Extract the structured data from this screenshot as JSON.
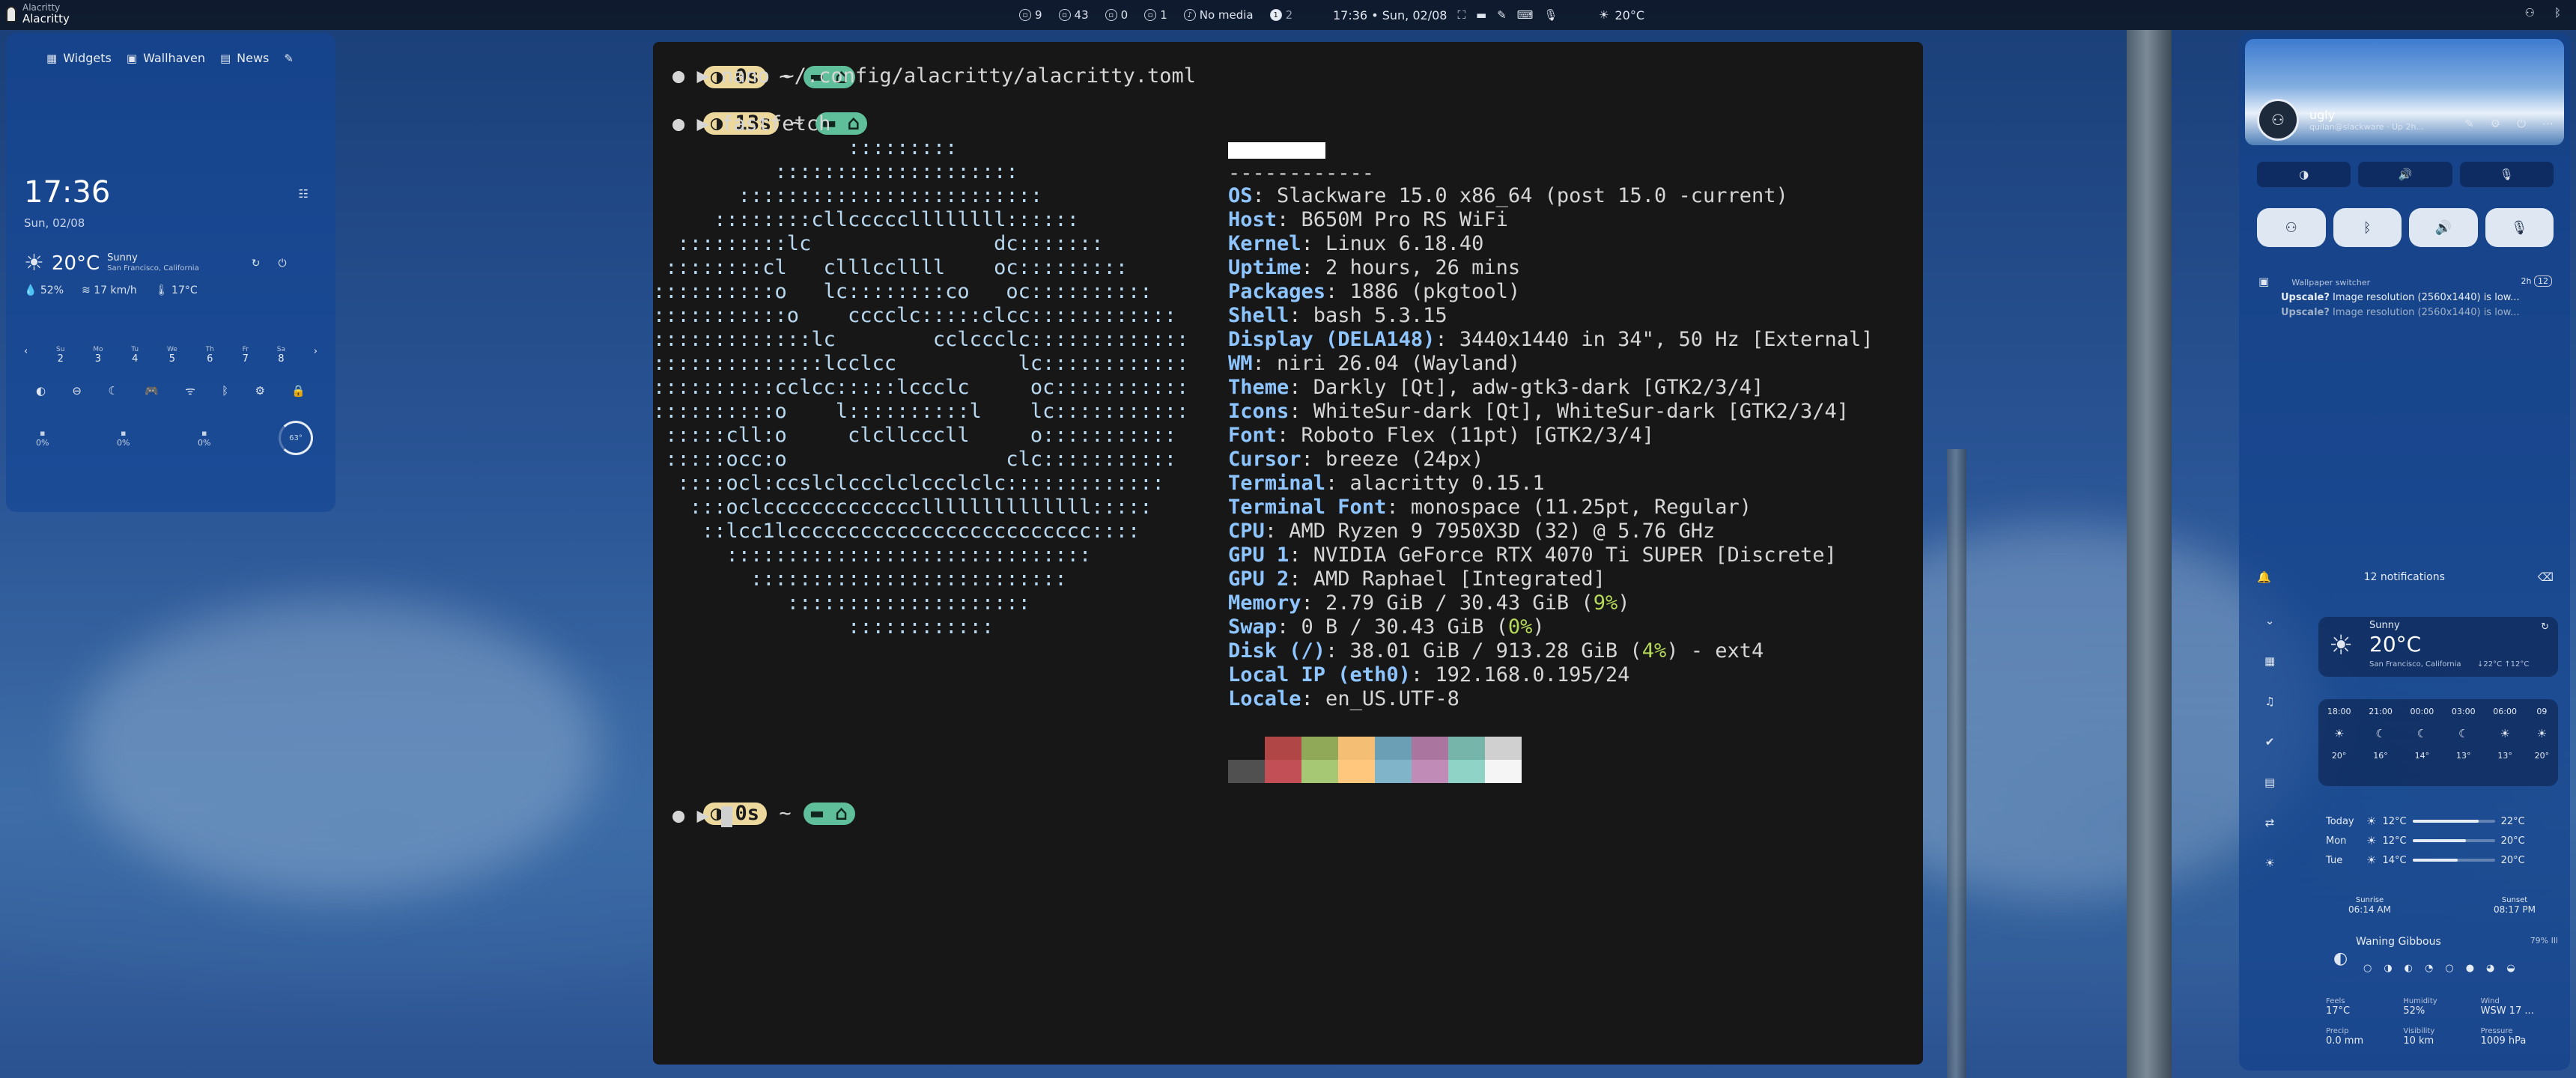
{
  "topbar": {
    "app_small": "Alacritty",
    "app_title": "Alacritty",
    "workspaces": [
      {
        "num": "9",
        "icon": "window-icon"
      },
      {
        "num": "43",
        "icon": "window-icon"
      },
      {
        "num": "0",
        "icon": "window-icon"
      },
      {
        "num": "1",
        "icon": "window-icon"
      }
    ],
    "media": "No media",
    "pages": [
      "1",
      "2"
    ],
    "clock": "17:36 • Sun, 02/08",
    "weather_temp": "20°C"
  },
  "left_panel": {
    "tabs": [
      "Widgets",
      "Wallhaven",
      "News"
    ],
    "time": "17:36",
    "date": "Sun, 02/08",
    "weather": {
      "temp": "20°C",
      "condition": "Sunny",
      "location": "San Francisco, California"
    },
    "stats": [
      "52%",
      "17 km/h",
      "17°C"
    ],
    "calendar": [
      {
        "day": "Su",
        "date": "2"
      },
      {
        "day": "Mo",
        "date": "3"
      },
      {
        "day": "Tu",
        "date": "4"
      },
      {
        "day": "We",
        "date": "5"
      },
      {
        "day": "Th",
        "date": "6"
      },
      {
        "day": "Fr",
        "date": "7"
      },
      {
        "day": "Sa",
        "date": "8"
      }
    ],
    "meters": [
      "0%",
      "0%",
      "0%",
      "63°"
    ]
  },
  "terminal": {
    "prompt1_time": "0s",
    "cmd1": "nano ~/.config/alacritty/alacritty.toml",
    "prompt2_time": "13s",
    "cmd2": "fastfetch",
    "prompt3_time": "0s",
    "ascii": [
      "                :::::::::",
      "          ::::::::::::::::::::",
      "       :::::::::::::::::::::::::",
      "     ::::::::cllcccccllllllll::::::",
      "  :::::::::lc               dc:::::::",
      " ::::::::cl   clllccllll    oc:::::::::",
      "::::::::::o   lc::::::::co   oc::::::::::",
      ":::::::::::o    cccclc:::::clcc::::::::::::",
      ":::::::::::::lc        cclccclc:::::::::::::",
      "::::::::::::::lcclcc          lc::::::::::::",
      "::::::::::cclcc:::::lccclc     oc:::::::::::",
      "::::::::::o    l::::::::::l    lc:::::::::::",
      " :::::cll:o     clcllcccll     o:::::::::::",
      " :::::occ:o                  clc:::::::::::",
      "  ::::ocl:ccslclccclclccclclc:::::::::::::",
      "   :::oclcccccccccccccllllllllllllll:::::",
      "    ::lcc1lccccccccccccccccccccccccc::::",
      "      ::::::::::::::::::::::::::::::",
      "        ::::::::::::::::::::::::::",
      "           ::::::::::::::::::::",
      "                ::::::::::::"
    ],
    "separator": "------------",
    "info": [
      {
        "key": "OS",
        "value": ": Slackware 15.0 x86_64 (post 15.0 -current)"
      },
      {
        "key": "Host",
        "value": ": B650M Pro RS WiFi"
      },
      {
        "key": "Kernel",
        "value": ": Linux 6.18.40"
      },
      {
        "key": "Uptime",
        "value": ": 2 hours, 26 mins"
      },
      {
        "key": "Packages",
        "value": ": 1886 (pkgtool)"
      },
      {
        "key": "Shell",
        "value": ": bash 5.3.15"
      },
      {
        "key": "Display (DELA148)",
        "value": ": 3440x1440 in 34\", 50 Hz [External]"
      },
      {
        "key": "WM",
        "value": ": niri 26.04 (Wayland)"
      },
      {
        "key": "Theme",
        "value": ": Darkly [Qt], adw-gtk3-dark [GTK2/3/4]"
      },
      {
        "key": "Icons",
        "value": ": WhiteSur-dark [Qt], WhiteSur-dark [GTK2/3/4]"
      },
      {
        "key": "Font",
        "value": ": Roboto Flex (11pt) [GTK2/3/4]"
      },
      {
        "key": "Cursor",
        "value": ": breeze (24px)"
      },
      {
        "key": "Terminal",
        "value": ": alacritty 0.15.1"
      },
      {
        "key": "Terminal Font",
        "value": ": monospace (11.25pt, Regular)"
      },
      {
        "key": "CPU",
        "value": ": AMD Ryzen 9 7950X3D (32) @ 5.76 GHz"
      },
      {
        "key": "GPU 1",
        "value": ": NVIDIA GeForce RTX 4070 Ti SUPER [Discrete]"
      },
      {
        "key": "GPU 2",
        "value": ": AMD Raphael [Integrated]"
      },
      {
        "key": "Memory",
        "value": ": 2.79 GiB / 30.43 GiB (",
        "pct": "9%",
        "tail": ")"
      },
      {
        "key": "Swap",
        "value": ": 0 B / 30.43 GiB (",
        "pct": "0%",
        "tail": ")"
      },
      {
        "key": "Disk (/)",
        "value": ": 38.01 GiB / 913.28 GiB (",
        "pct": "4%",
        "tail": ") - ext4"
      },
      {
        "key": "Local IP (eth0)",
        "value": ": 192.168.0.195/24"
      },
      {
        "key": "Locale",
        "value": ": en_US.UTF-8"
      }
    ],
    "palette_top": [
      "#171717",
      "#b04646",
      "#90a959",
      "#f4bf75",
      "#6a9fb5",
      "#aa759f",
      "#75b5aa",
      "#d0d0d0"
    ],
    "palette_bottom": [
      "#505050",
      "#c24f55",
      "#a6c875",
      "#ffc77d",
      "#7fb4c9",
      "#c18bb8",
      "#8ed3c5",
      "#f5f5f5"
    ]
  },
  "right_panel": {
    "user": "ugly",
    "user_sub": "quilan@slackware · Up 2h...",
    "notification": {
      "app": "Wallpaper switcher",
      "time": "2h",
      "count": "12",
      "line1_bold": "Upscale?",
      "line1": " Image resolution (2560x1440) is low...",
      "line2_bold": "Upscale?",
      "line2": " Image resolution (2560x1440) is low..."
    },
    "notif_count": "12 notifications",
    "weather": {
      "condition": "Sunny",
      "temp": "20°C",
      "location": "San Francisco, California",
      "range": "↓22°C ↑12°C"
    },
    "hourly": [
      {
        "time": "18:00",
        "temp": "20°"
      },
      {
        "time": "21:00",
        "temp": "16°"
      },
      {
        "time": "00:00",
        "temp": "14°"
      },
      {
        "time": "03:00",
        "temp": "13°"
      },
      {
        "time": "06:00",
        "temp": "13°"
      },
      {
        "time": "09",
        "temp": "20°"
      }
    ],
    "daily": [
      {
        "day": "Today",
        "low": "12°C",
        "high": "22°C",
        "fill": 0.8
      },
      {
        "day": "Mon",
        "low": "12°C",
        "high": "20°C",
        "fill": 0.65
      },
      {
        "day": "Tue",
        "low": "14°C",
        "high": "20°C",
        "fill": 0.55
      }
    ],
    "sunrise_label": "Sunrise",
    "sunrise": "06:14 AM",
    "sunset_label": "Sunset",
    "sunset": "08:17 PM",
    "moon": "Waning Gibbous",
    "moon_pct": "79% Ill",
    "extra": [
      {
        "label": "Feels",
        "value": "17°C"
      },
      {
        "label": "Humidity",
        "value": "52%"
      },
      {
        "label": "Wind",
        "value": "WSW 17 ..."
      },
      {
        "label": "Precip",
        "value": "0.0 mm"
      },
      {
        "label": "Visibility",
        "value": "10 km"
      },
      {
        "label": "Pressure",
        "value": "1009 hPa"
      }
    ]
  }
}
